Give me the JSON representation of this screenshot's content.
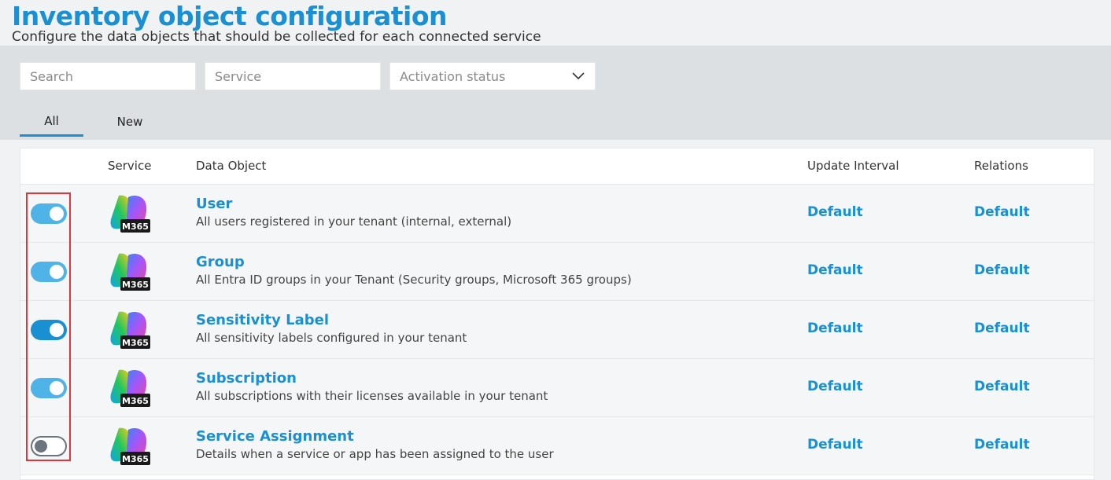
{
  "header": {
    "title": "Inventory object configuration",
    "subtitle": "Configure the data objects that should be collected for each connected service"
  },
  "filters": {
    "search_placeholder": "Search",
    "service_placeholder": "Service",
    "activation_placeholder": "Activation status"
  },
  "tabs": [
    {
      "label": "All",
      "active": true
    },
    {
      "label": "New",
      "active": false
    }
  ],
  "table": {
    "columns": [
      "Service",
      "Data Object",
      "Update Interval",
      "Relations"
    ],
    "rows": [
      {
        "enabled": true,
        "service_badge": "M365",
        "name": "User",
        "description": "All users registered in your tenant (internal, external)",
        "update_interval": "Default",
        "relations": "Default"
      },
      {
        "enabled": true,
        "service_badge": "M365",
        "name": "Group",
        "description": "All Entra ID groups in your Tenant (Security groups, Microsoft 365 groups)",
        "update_interval": "Default",
        "relations": "Default"
      },
      {
        "enabled": true,
        "service_badge": "M365",
        "name": "Sensitivity Label",
        "description": "All sensitivity labels configured in your tenant",
        "update_interval": "Default",
        "relations": "Default"
      },
      {
        "enabled": true,
        "service_badge": "M365",
        "name": "Subscription",
        "description": "All subscriptions with their licenses available in your tenant",
        "update_interval": "Default",
        "relations": "Default"
      },
      {
        "enabled": false,
        "service_badge": "M365",
        "name": "Service Assignment",
        "description": "Details when a service or app has been assigned to the user",
        "update_interval": "Default",
        "relations": "Default"
      }
    ]
  },
  "colors": {
    "accent": "#1a8fd1",
    "toggle_on": "#4fb3e8",
    "highlight": "#e0353a"
  }
}
